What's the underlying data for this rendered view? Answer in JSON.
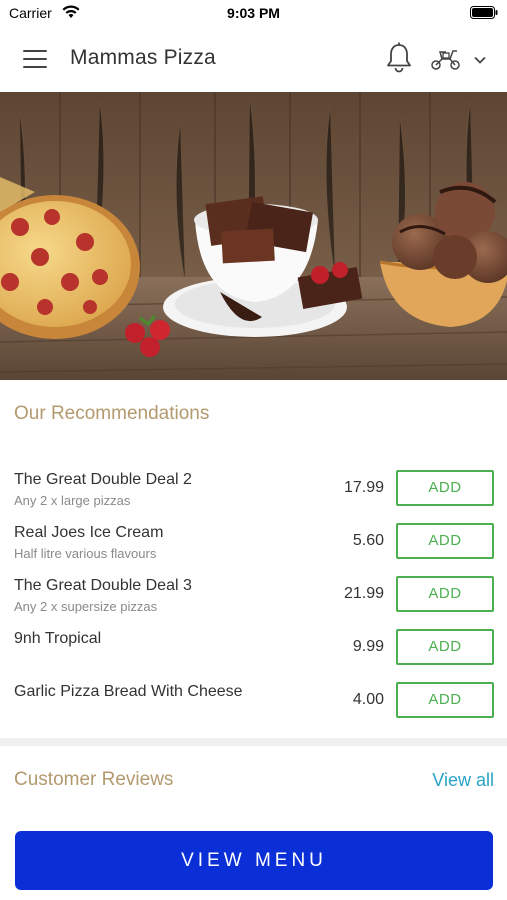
{
  "status_bar": {
    "carrier": "Carrier",
    "time": "9:03 PM"
  },
  "header": {
    "title": "Mammas Pizza",
    "icons": [
      "menu-icon",
      "bell-icon",
      "scooter-icon",
      "chevron-down-icon"
    ]
  },
  "hero": {
    "image": "food-banner"
  },
  "recommendations": {
    "title": "Our Recommendations",
    "items": [
      {
        "name": "The Great Double Deal 2",
        "description": "Any 2 x large pizzas",
        "price": "17.99",
        "button": "ADD"
      },
      {
        "name": "Real Joes Ice Cream",
        "description": "Half litre various flavours",
        "price": "5.60",
        "button": "ADD"
      },
      {
        "name": "The Great Double Deal 3",
        "description": "Any 2 x supersize pizzas",
        "price": "21.99",
        "button": "ADD"
      },
      {
        "name": "9nh Tropical",
        "description": "",
        "price": "9.99",
        "button": "ADD"
      },
      {
        "name": "Garlic Pizza Bread With Cheese",
        "description": "",
        "price": "4.00",
        "button": "ADD"
      }
    ]
  },
  "reviews": {
    "title": "Customer Reviews",
    "view_all": "View all"
  },
  "footer": {
    "view_menu": "VIEW MENU"
  },
  "colors": {
    "accent_gold": "#b39a6e",
    "add_green": "#4caf50",
    "link_blue": "#2aa3c8",
    "button_blue": "#0a2fd6"
  }
}
